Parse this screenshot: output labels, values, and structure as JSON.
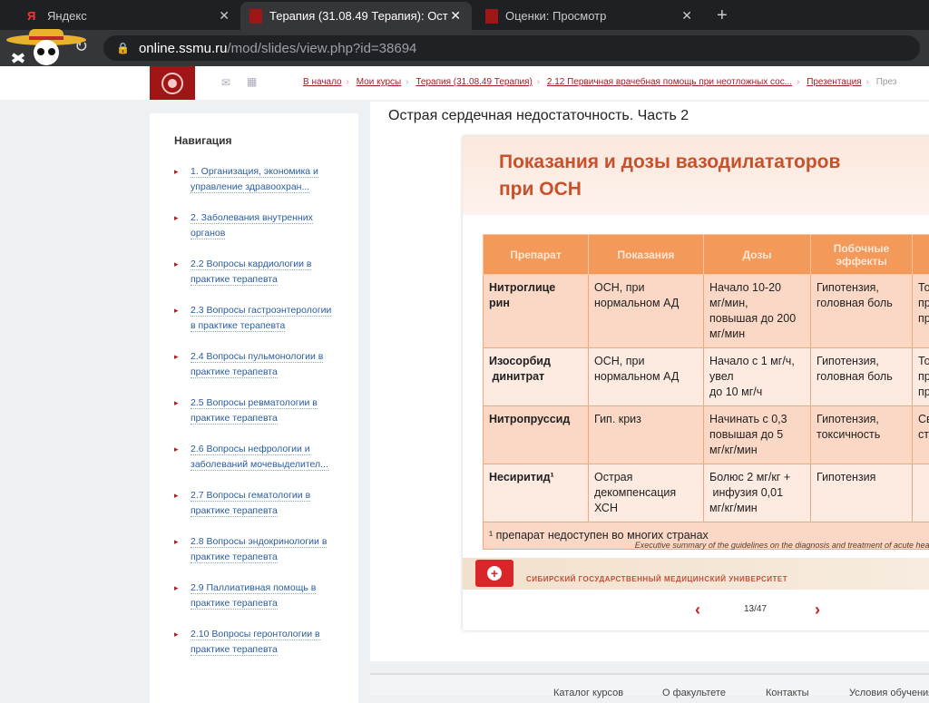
{
  "browser": {
    "tabs": [
      {
        "label": "Яндекс",
        "active": false
      },
      {
        "label": "Терапия (31.08.49 Терапия): Ост",
        "active": true
      },
      {
        "label": "Оценки: Просмотр",
        "active": false
      }
    ],
    "url_domain": "online.ssmu.ru",
    "url_path": "/mod/slides/view.php?id=38694"
  },
  "breadcrumbs": [
    "В начало",
    "Мои курсы",
    "Терапия (31.08.49 Терапия)",
    "2.12 Первичная врачебная помощь при неотложных сос...",
    "Презентация",
    "През"
  ],
  "sidebar": {
    "title": "Навигация",
    "items": [
      "1. Организация, экономика и управление здравоохран...",
      "2. Заболевания внутренних органов",
      "2.2 Вопросы кардиологии в практике терапевта",
      "2.3 Вопросы гастроэнтерологии в практике терапевта",
      "2.4 Вопросы пульмонологии в практике терапевта",
      "2.5 Вопросы ревматологии в практике терапевта",
      "2.6 Вопросы нефрологии и заболеваний мочевыделител...",
      "2.7 Вопросы гематологии в практике терапевта",
      "2.8 Вопросы эндокринологии в практике терапевта",
      "2.9 Паллиативная помощь в практике терапевта",
      "2.10 Вопросы геронтологии в практике терапевта"
    ]
  },
  "page_title": "Острая сердечная недостаточность. Часть 2",
  "slide": {
    "title_line1": "Показания и дозы вазодилататоров",
    "title_line2": "при ОСН",
    "headers": [
      "Препарат",
      "Показания",
      "Дозы",
      "Побочные эффекты",
      ""
    ],
    "rows": [
      [
        "Нитроглице\nрин",
        "ОСН, при\nнормальном АД",
        "Начало 10-20\nмг/мин,\nповышая до 200\nмг/мин",
        "Гипотензия,\nголовная боль",
        "То\nпр\nпр"
      ],
      [
        "Изосорбид\n динитрат",
        "ОСН, при\nнормальном АД",
        "Начало с 1 мг/ч,\nувел\nдо 10 мг/ч",
        "Гипотензия,\nголовная боль",
        "То\nпр\nпр"
      ],
      [
        "Нитропруссид",
        "Гип. криз",
        "Начинать с 0,3\nповышая до 5\nмг/кг/мин",
        "Гипотензия,\nтоксичность",
        "Св\nст"
      ],
      [
        "Несиритид¹",
        "Острая\nдекомпенсация\nХСН",
        "Болюс 2 мг/кг +\n инфузия 0,01\nмг/кг/мин",
        "Гипотензия",
        ""
      ]
    ],
    "footnote": "¹ препарат недоступен во многих странах",
    "citation": "Executive summary of the guidelines on the diagnosis and treatment of acute heart",
    "university": "СИБИРСКИЙ ГОСУДАРСТВЕННЫЙ МЕДИЦИНСКИЙ УНИВЕРСИТЕТ"
  },
  "pager": {
    "current": "13/47"
  },
  "footer": [
    "Каталог курсов",
    "О факультете",
    "Контакты",
    "Условия обучения"
  ]
}
